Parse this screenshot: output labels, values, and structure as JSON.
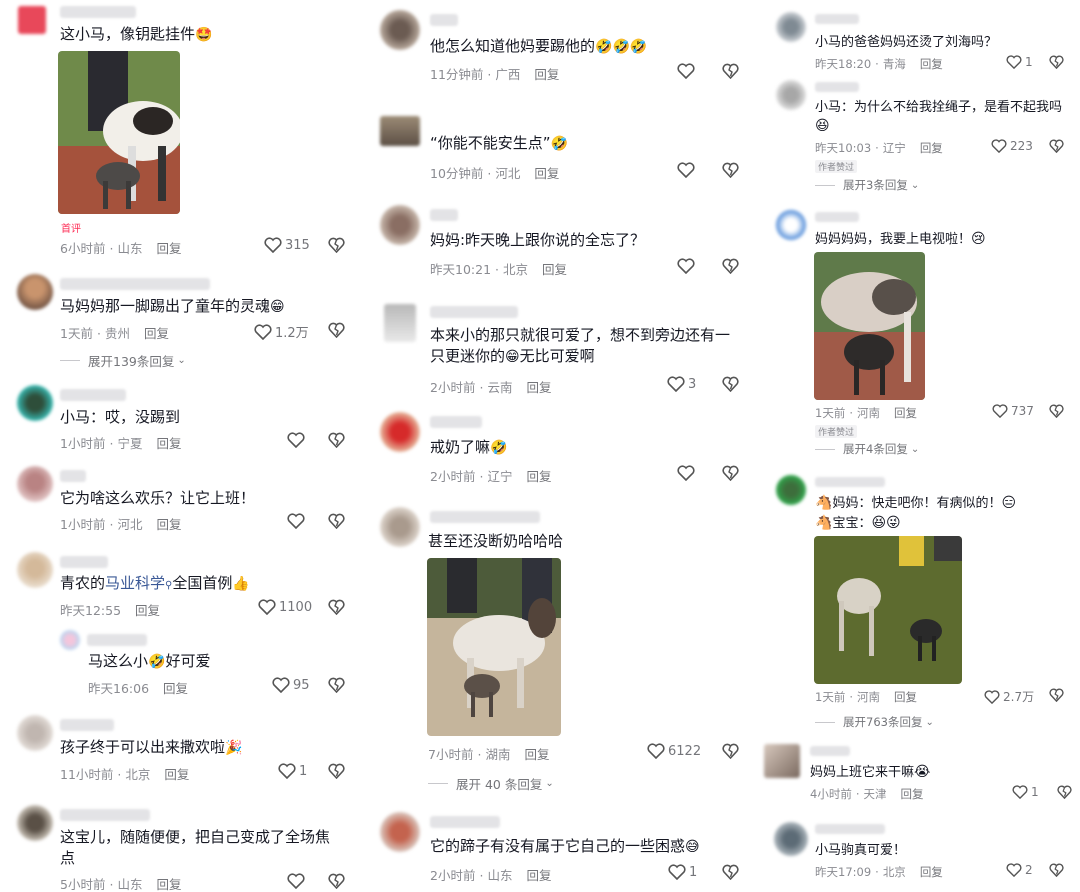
{
  "colors": {
    "accent": "#fe2c55",
    "text": "#161823",
    "meta": "#8a8b91",
    "link": "#3a5896"
  },
  "left": {
    "c1": {
      "text": "这小马，像钥匙挂件",
      "emoji": "🤩",
      "badge": "首评",
      "time": "6小时前",
      "loc": "山东",
      "reply": "回复",
      "likes": "315"
    },
    "c2": {
      "text": "马妈妈那一脚踢出了童年的灵魂",
      "emoji": "😁",
      "time": "1天前",
      "loc": "贵州",
      "reply": "回复",
      "likes": "1.2万",
      "expand": "展开139条回复"
    },
    "c3": {
      "text": "小马：哎，没踢到",
      "time": "1小时前",
      "loc": "宁夏",
      "reply": "回复"
    },
    "c4": {
      "text": "它为啥这么欢乐？让它上班！",
      "time": "1小时前",
      "loc": "河北",
      "reply": "回复"
    },
    "c5": {
      "text_a": "青农的",
      "link": "马业科学",
      "search": "⚲",
      "text_b": "全国首例",
      "emoji": "👍",
      "time": "昨天12:55",
      "reply": "回复",
      "likes": "1100"
    },
    "c5r": {
      "text": "马这么小",
      "emoji": "🤣",
      "text_b": "好可爱",
      "time": "昨天16:06",
      "reply": "回复",
      "likes": "95"
    },
    "c6": {
      "text": "孩子终于可以出来撒欢啦",
      "emoji": "🎉",
      "time": "11小时前",
      "loc": "北京",
      "reply": "回复",
      "likes": "1"
    },
    "c7": {
      "text": "这宝儿，随随便便，把自己变成了全场焦点",
      "time": "5小时前",
      "loc": "山东",
      "reply": "回复"
    }
  },
  "mid": {
    "c1": {
      "text": "他怎么知道他妈要踢他的",
      "emoji": "🤣🤣🤣",
      "time": "11分钟前",
      "loc": "广西",
      "reply": "回复"
    },
    "c2": {
      "text": "“你能不能安生点”",
      "emoji": "🤣",
      "time": "10分钟前",
      "loc": "河北",
      "reply": "回复"
    },
    "c3": {
      "text": "妈妈:昨天晚上跟你说的全忘了？",
      "time": "昨天10:21",
      "loc": "北京",
      "reply": "回复"
    },
    "c4": {
      "text": "本来小的那只就很可爱了，想不到旁边还有一只更迷你的",
      "emoji": "😁",
      "text_b": "无比可爱啊",
      "time": "2小时前",
      "loc": "云南",
      "reply": "回复",
      "likes": "3"
    },
    "c5": {
      "text": "戒奶了嘛",
      "emoji": "🤣",
      "time": "2小时前",
      "loc": "辽宁",
      "reply": "回复"
    },
    "c6": {
      "text": "甚至还没断奶哈哈哈",
      "time": "7小时前",
      "loc": "湖南",
      "reply": "回复",
      "likes": "6122",
      "expand": "展开 40 条回复"
    },
    "c7": {
      "text": "它的蹄子有没有属于它自己的一些困惑",
      "emoji": "😅",
      "time": "2小时前",
      "loc": "山东",
      "reply": "回复",
      "likes": "1"
    }
  },
  "right": {
    "c1": {
      "text": "小马的爸爸妈妈还烫了刘海吗？",
      "time": "昨天18:20",
      "loc": "青海",
      "reply": "回复",
      "likes": "1"
    },
    "c2": {
      "text": "小马：为什么不给我拴绳子，是看不起我吗",
      "emoji": "😆",
      "time": "昨天10:03",
      "loc": "辽宁",
      "reply": "回复",
      "likes": "223",
      "badge": "作者赞过",
      "expand": "展开3条回复"
    },
    "c3": {
      "text": "妈妈妈妈，我要上电视啦！",
      "emoji": "😢",
      "time": "1天前",
      "loc": "河南",
      "reply": "回复",
      "likes": "737",
      "badge": "作者赞过",
      "expand": "展开4条回复"
    },
    "c4": {
      "line1_icon": "🐴",
      "line1": "妈妈：快走吧你！有病似的！",
      "line1_emoji": "😑",
      "line2_icon": "🐴",
      "line2": "宝宝：",
      "line2_emoji": "😆😜",
      "time": "1天前",
      "loc": "河南",
      "reply": "回复",
      "likes": "2.7万",
      "expand": "展开763条回复"
    },
    "c5": {
      "text": "妈妈上班它来干嘛",
      "emoji": "😭",
      "time": "4小时前",
      "loc": "天津",
      "reply": "回复",
      "likes": "1"
    },
    "c6": {
      "text": "小马驹真可爱！",
      "time": "昨天17:09",
      "loc": "北京",
      "reply": "回复",
      "likes": "2"
    }
  },
  "icons": {
    "like": "heart-outline-icon",
    "dislike": "broken-heart-icon",
    "expand": "chevron-down-icon"
  }
}
